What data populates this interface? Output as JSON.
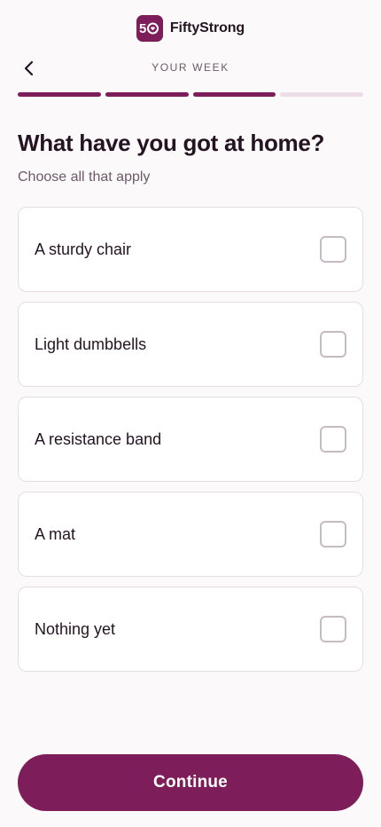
{
  "brand": {
    "logo_text": "50",
    "name": "FiftyStrong"
  },
  "header": {
    "back_icon": "chevron-left-icon",
    "step_title": "YOUR WEEK"
  },
  "progress": {
    "segments_total": 4,
    "segments_complete": 3
  },
  "question": {
    "title": "What have you got at home?",
    "hint": "Choose all that apply"
  },
  "options": [
    {
      "label": "A sturdy chair",
      "checked": false
    },
    {
      "label": "Light dumbbells",
      "checked": false
    },
    {
      "label": "A resistance band",
      "checked": false
    },
    {
      "label": "A mat",
      "checked": false
    },
    {
      "label": "Nothing yet",
      "checked": false
    }
  ],
  "actions": {
    "continue_label": "Continue"
  },
  "colors": {
    "brand": "#7d1e5a",
    "background": "#fcf9fa",
    "progress_inactive": "#ecdde6"
  }
}
